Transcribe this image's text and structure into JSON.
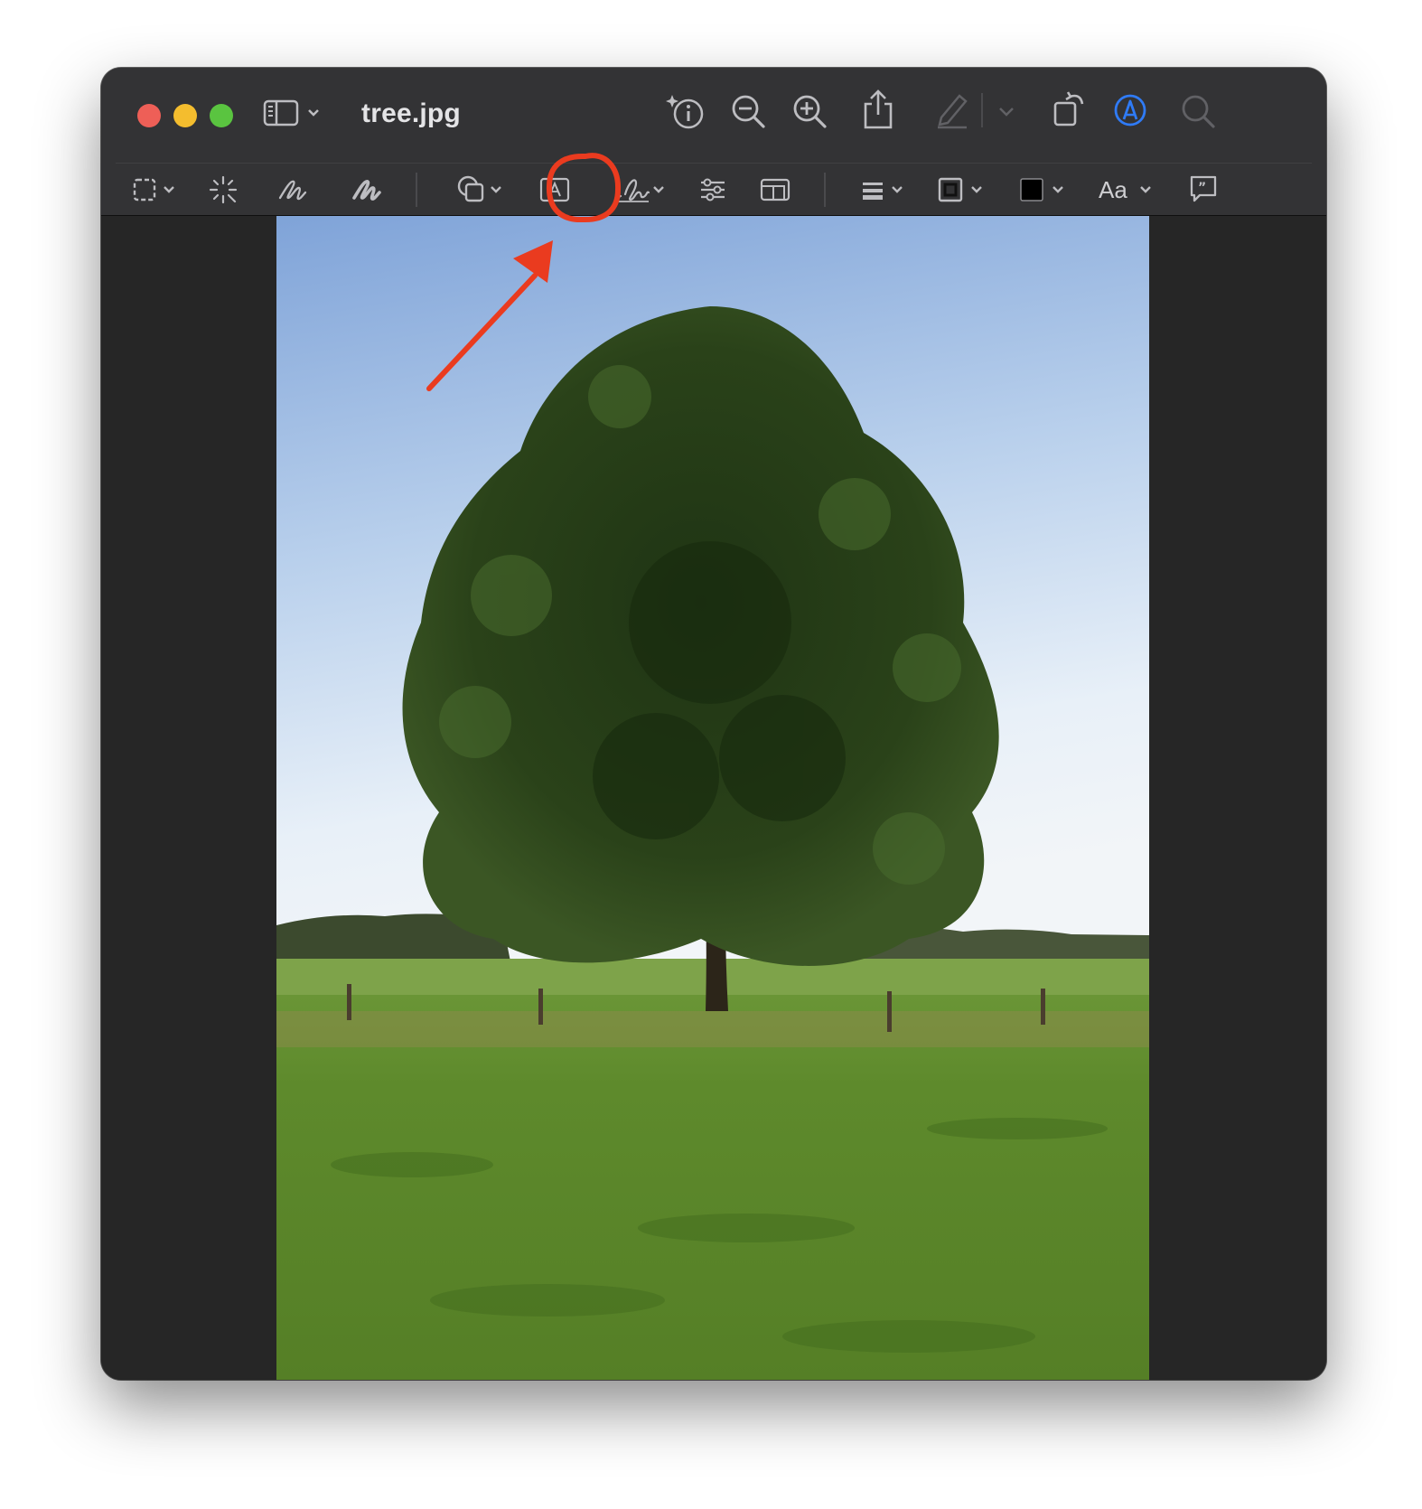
{
  "window": {
    "title": "tree.jpg"
  },
  "toolbar": {
    "font_label": "Aa"
  },
  "icons": {
    "sidebar": "sidebar-icon",
    "info": "info-icon",
    "zoom_out": "zoom-out-icon",
    "zoom_in": "zoom-in-icon",
    "share": "share-icon",
    "highlight": "highlighter-icon",
    "rotate": "rotate-icon",
    "markup": "markup-icon",
    "search": "search-icon",
    "selection": "rectangular-selection-icon",
    "instant_alpha": "instant-alpha-icon",
    "sketch": "sketch-icon",
    "draw": "draw-icon",
    "shapes": "shapes-icon",
    "text": "text-box-icon",
    "sign": "signature-icon",
    "adjust": "adjust-color-icon",
    "size": "adjust-size-icon",
    "shape_style": "shape-style-icon",
    "border_color": "border-color-icon",
    "fill_color": "fill-color-icon",
    "note": "note-icon"
  },
  "colors": {
    "accent": "#2f7bf6",
    "annotation": "#ea3b1f",
    "window_bg": "#262626",
    "titlebar_bg": "#333335"
  }
}
